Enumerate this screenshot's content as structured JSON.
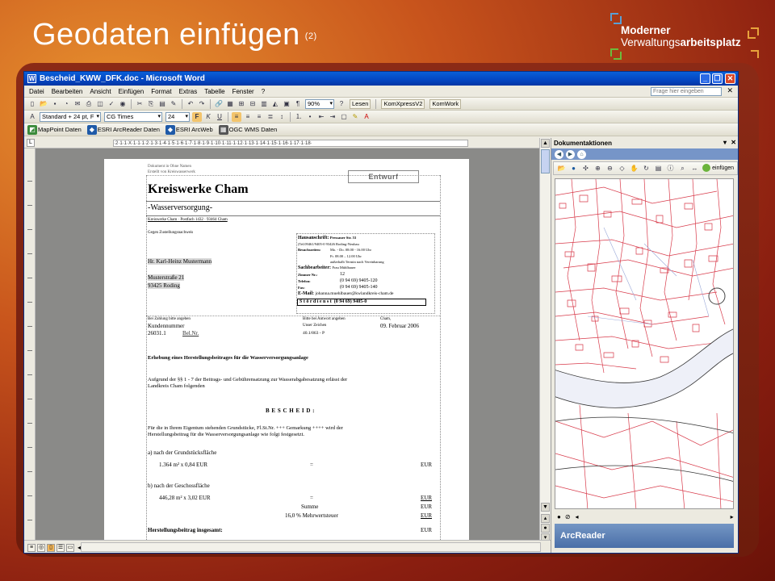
{
  "slide": {
    "title": "Geodaten einfügen",
    "number": "(2)",
    "logo_line1": "Moderner",
    "logo_line2a": "Verwaltungs",
    "logo_line2b": "arbeitsplatz"
  },
  "window": {
    "title": "Bescheid_KWW_DFK.doc - Microsoft Word",
    "menu": [
      "Datei",
      "Bearbeiten",
      "Ansicht",
      "Einfügen",
      "Format",
      "Extras",
      "Tabelle",
      "Fenster",
      "?"
    ],
    "ask_placeholder": "Frage hier eingeben",
    "zoom": "90%",
    "lesen_label": "Lesen",
    "komxpress_label": "KomXpressV2",
    "komwork_label": "KomWork",
    "style_value": "Standard + 24 pt, F",
    "font_value": "CG Times",
    "size_value": "24",
    "toolbar3": [
      "MapPoint Daten",
      "ESRI ArcReader Daten",
      "ESRI ArcWeb",
      "OGC WMS Daten"
    ],
    "ruler_text": "·2·1·1·X·1·1·1·2·1·3·1·4·1·5·1·6·1·7·1·8·1·9·1·10·1·11·1·12·1·13·1·14·1·15·1·16·1·17·1·18·"
  },
  "document": {
    "meta1": "Dokument in Ohne Namen",
    "meta2": "Erstellt von Kreiswasserwerk",
    "stamp": "Entwurf",
    "org": "Kreiswerke Cham",
    "dept": "-Wasserversorgung-",
    "sender": "Kreiswerke Cham · Postfach 1432 · 93464 Cham",
    "zustellung": "Gegen Zustellungsnachweis",
    "recipient_name": "Hr. Karl-Heinz Mustermann",
    "recipient_street": "Musterstraße 21",
    "recipient_city": "93425 Roding",
    "hausanschrift_label": "Hausanschrift:",
    "hausanschrift_value": "Pressauer Str. 53",
    "address_line2": "(Tel.09461/9405-0   93426 Roding-Neubau",
    "sprechzeiten_label": "Besuchszeiten:",
    "sprech1": "Mo. - Do. 08.00 - 16.00 Uhr",
    "sprech2": "Fr.        08.00 – 12.00 Uhr",
    "sprech3": "außerhalb Termin nach Vereinbarung",
    "sachbearbeiter_label": "Sachbearbeiter:",
    "sachbearbeiter_value": "Frau Mühlbauer",
    "zimmer_label": "Zimmer Nr.:",
    "zimmer_value": "12",
    "telefon_label": "Telefon:",
    "telefon_value": "(0 94 69)     9405-120",
    "fax_label": "Fax:",
    "fax_value": "(0 94 69)     9405-140",
    "email_label": "E-Mail:",
    "email_value": "johanna.muehlbauer@kwlandkreis-cham.de",
    "stoer_label": "S t ö r d i e n s t",
    "stoer_value": "(0 94 69)     9405-0",
    "zahlung": "Bei Zahlung bitte angeben",
    "kundennummer_label": "Kundennummer",
    "kundennummer_value": "26031.1",
    "belnr": "Bel.Nr.",
    "antwort": "Bitte bei Antwort angeben",
    "unser_zeichen": "Unser Zeichen",
    "zeichen_value": "40.1/863 - P",
    "ort": "Cham,",
    "datum": "09. Februar 2006",
    "betreff": "Erhebung eines Herstellungsbeitrages für die Wasserversorgungsanlage",
    "para1a": "Aufgrund der §§ 1 - 7 der Beitrags- und Gebührensatzung zur Wasserabgabesatzung erlässt der",
    "para1b": "Landkreis Cham folgenden",
    "bescheid": "B E S C H E I D :",
    "para2a": "Für die in Ihrem Eigentum stehenden Grundstücke, Fl.St.Nr. +++ Gemarkung ++++ wird der",
    "para2b": "Herstellungsbeitrag für die Wasserversorgungsanlage wie folgt festgesetzt.",
    "a_label": "a) nach der Grundstücksfläche",
    "a_calc": "1.364 m² x 0,84 EUR",
    "eq": "=",
    "eur": "EUR",
    "b_label": "b) nach der Geschossfläche",
    "b_calc": "446,28 m² x 3,02 EUR",
    "summe": "Summe",
    "mwst": "16,0 %  Mehrwertsteuer",
    "cut": "Herstellungsbeitrag insgesamt:"
  },
  "pane": {
    "title": "Dokumentaktionen",
    "einfuegen": "einfügen",
    "brand": "ArcReader"
  }
}
